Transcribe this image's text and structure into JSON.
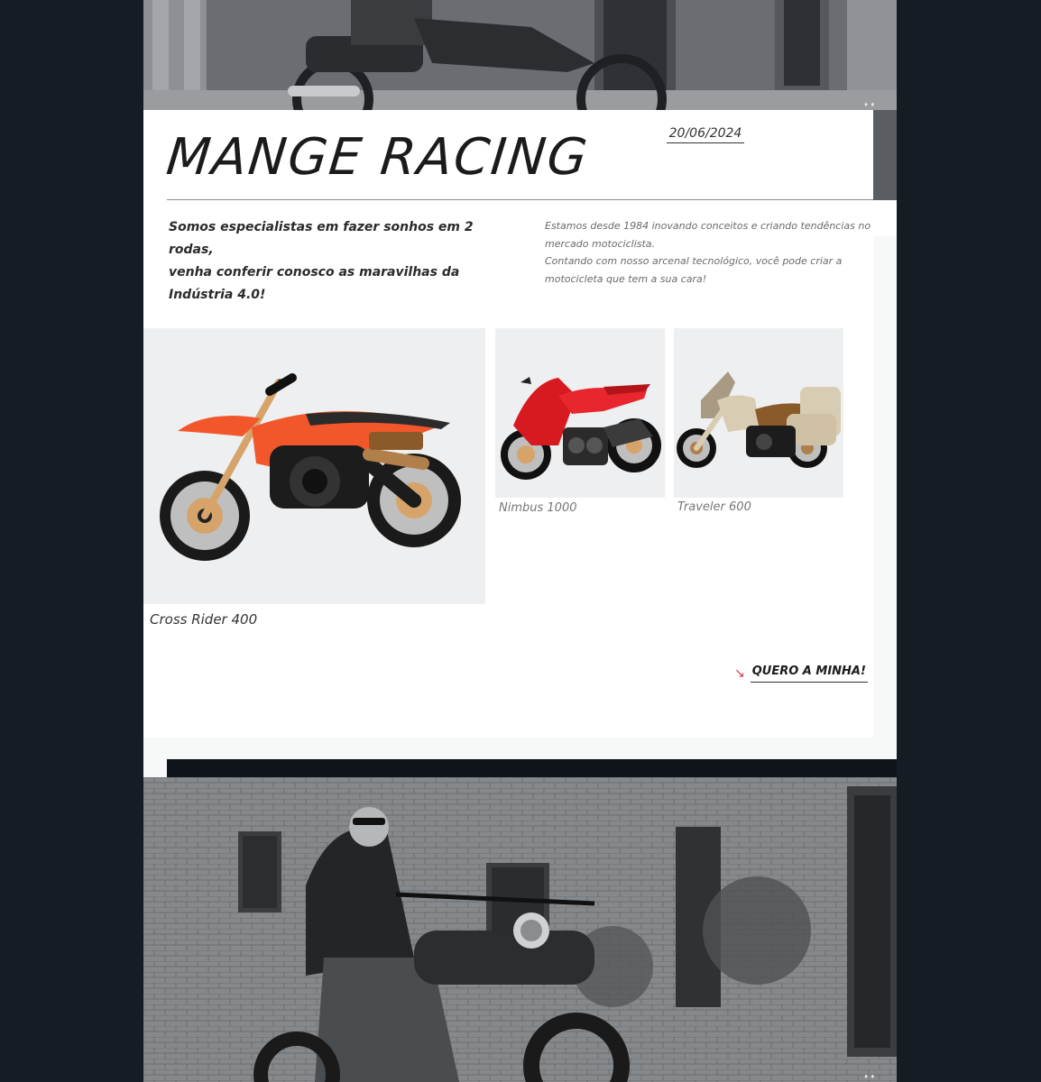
{
  "header": {
    "title": "MANGE RACING",
    "date": "20/06/2024"
  },
  "intro": {
    "slogan_line1": "Somos especialistas em fazer sonhos em 2 rodas,",
    "slogan_line2": "venha conferir conosco as maravilhas da Indústria 4.0!",
    "about_p1": "Estamos desde 1984 inovando conceitos e criando tendências no mercado motociclista.",
    "about_p2": "Contando com nosso arcenal tecnológico, você pode criar a motocicleta que tem a sua cara!"
  },
  "products": [
    {
      "name": "Cross Rider 400",
      "image": "orange-dirt-bike-illustration"
    },
    {
      "name": "Nimbus 1000",
      "image": "red-sport-bike-illustration"
    },
    {
      "name": "Traveler 600",
      "image": "beige-touring-bike-illustration"
    }
  ],
  "cta": {
    "label": "QUERO A MINHA!",
    "icon": "arrow-down-right-icon"
  },
  "photos": {
    "top": "motorcyclist-by-building-photo",
    "bottom": "man-with-sunglasses-on-motorcycle-photo"
  },
  "colors": {
    "background": "#151c23",
    "card": "#ffffff",
    "accent": "#d83a4e",
    "tile": "#eeeff0"
  }
}
